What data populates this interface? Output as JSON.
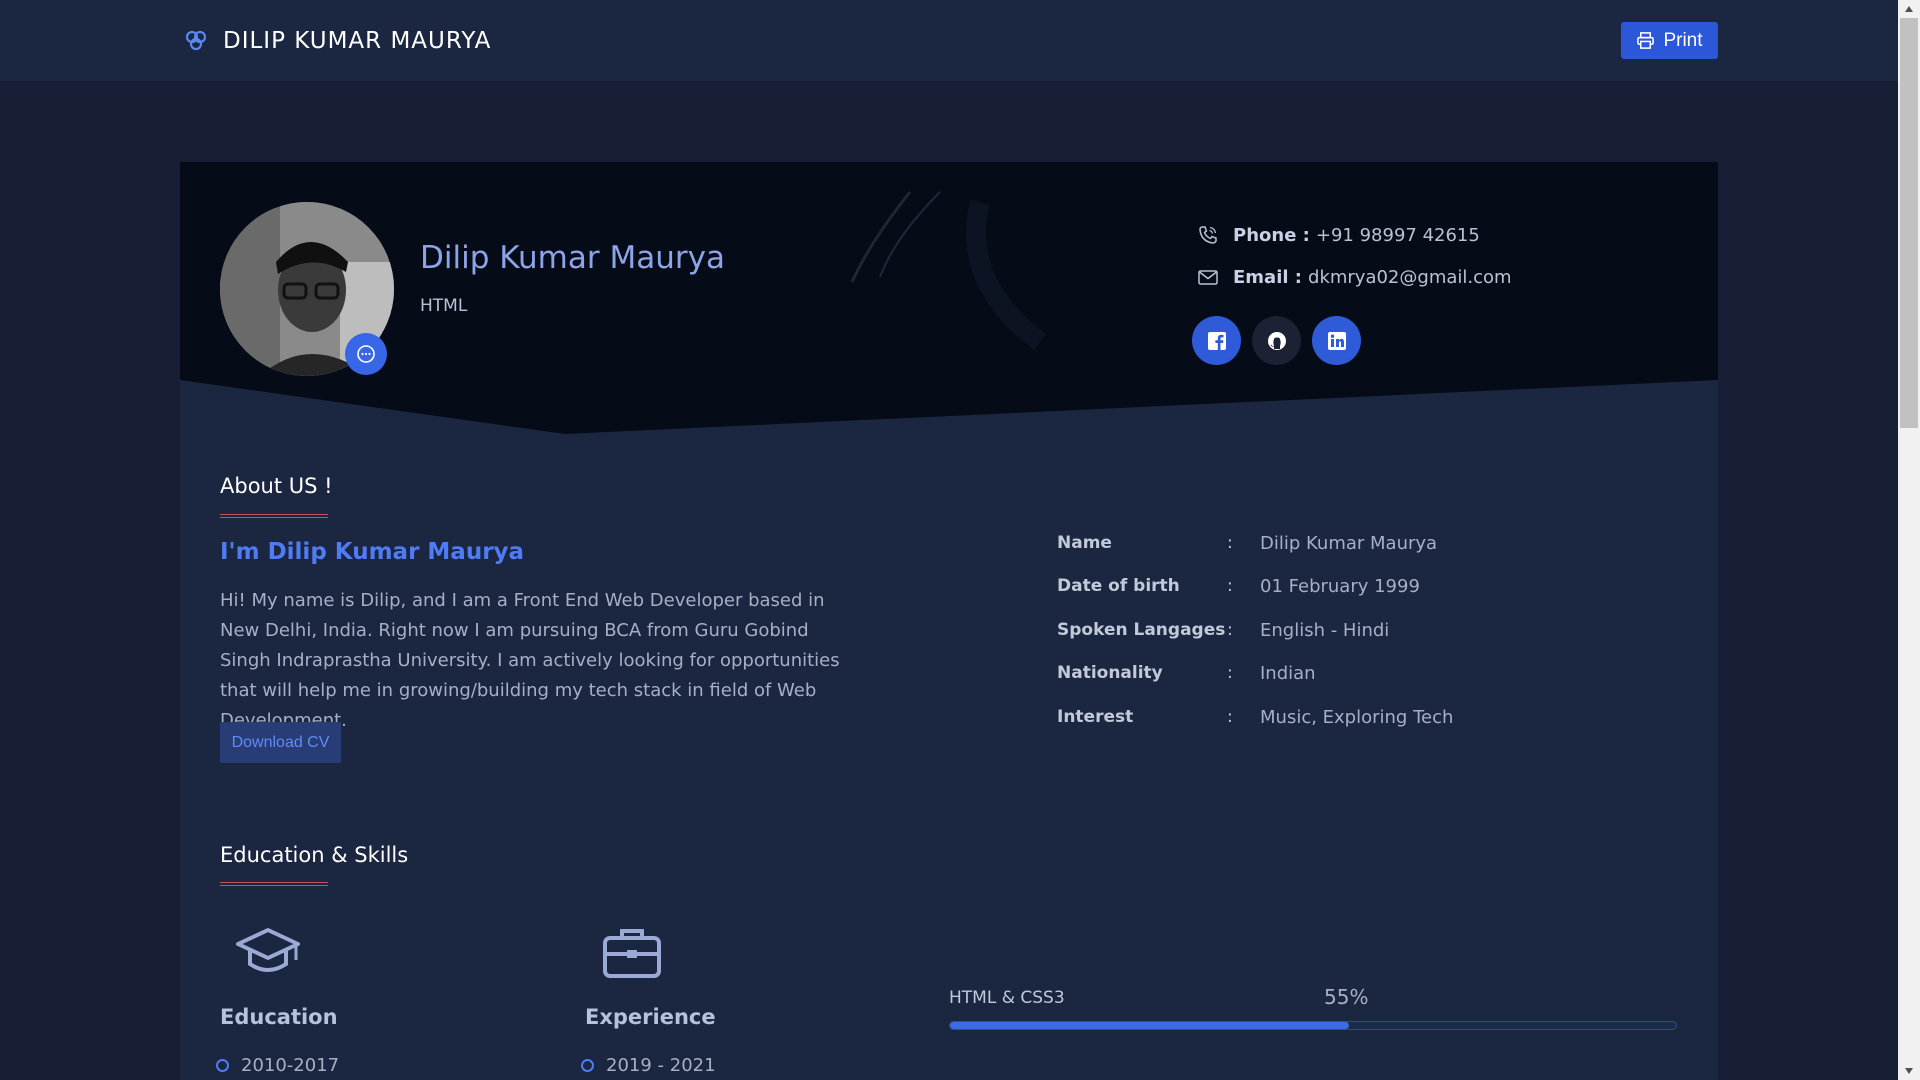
{
  "navbar": {
    "brand": "DILIP KUMAR MAURYA",
    "print_label": "Print"
  },
  "profile": {
    "name": "Dilip Kumar Maurya",
    "role": "HTML",
    "phone_label": "Phone :",
    "phone": "+91 98997 42615",
    "email_label": "Email :",
    "email": "dkmrya02@gmail.com",
    "socials": [
      "facebook-icon",
      "github-icon",
      "linkedin-icon"
    ]
  },
  "about": {
    "title": "About US !",
    "heading": "I'm Dilip Kumar Maurya",
    "text": "Hi! My name is Dilip, and I am a Front End Web Developer based in New Delhi, India. Right now I am pursuing BCA from Guru Gobind Singh Indraprastha University. I am actively looking for opportunities that will help me in growing/building my tech stack in field of Web Development.",
    "download_label": "Download CV",
    "info": [
      {
        "label": "Name",
        "value": "Dilip Kumar Maurya"
      },
      {
        "label": "Date of birth",
        "value": "01 February 1999"
      },
      {
        "label": "Spoken Langages",
        "value": "English - Hindi"
      },
      {
        "label": "Nationality",
        "value": "Indian"
      },
      {
        "label": "Interest",
        "value": "Music, Exploring Tech"
      }
    ],
    "colon": ":"
  },
  "education_skills": {
    "title": "Education & Skills",
    "education": {
      "title": "Education",
      "first_item": "2010-2017"
    },
    "experience": {
      "title": "Experience",
      "first_item": "2019 - 2021"
    },
    "skill": {
      "label": "HTML & CSS3",
      "percent_text": "55%",
      "percent": 55
    }
  },
  "colors": {
    "accent": "#3767e6",
    "heading_blue": "#4f7cf5",
    "underline_red": "#c7505f",
    "background": "#171f37"
  }
}
